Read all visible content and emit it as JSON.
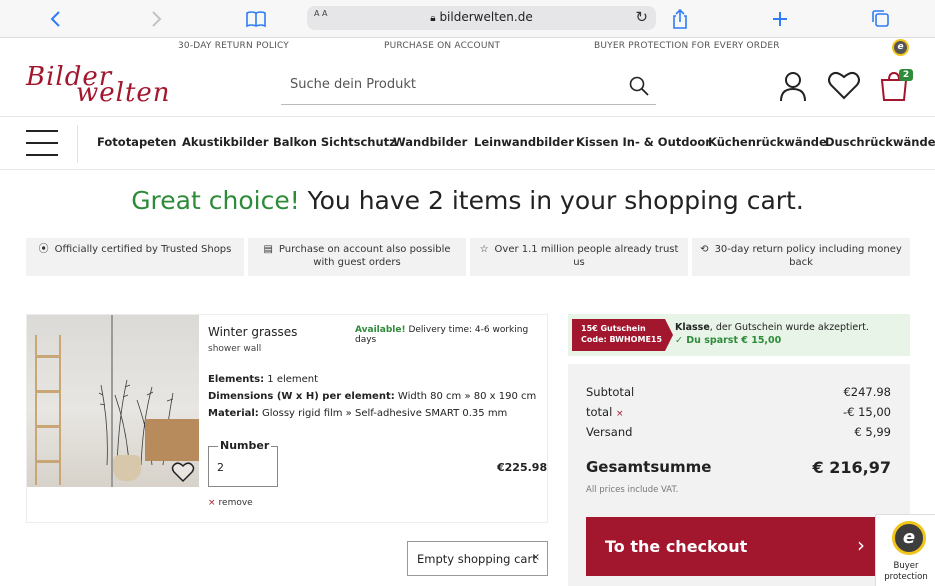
{
  "browser": {
    "url": "bilderwelten.de",
    "reader_label": "A A"
  },
  "usp": [
    "30-DAY RETURN POLICY",
    "PURCHASE ON ACCOUNT",
    "BUYER PROTECTION FOR EVERY ORDER"
  ],
  "header": {
    "logo_line1": "Bilder",
    "logo_line2": "welten",
    "search_placeholder": "Suche dein Produkt",
    "cart_count": "2"
  },
  "nav": {
    "items": [
      "Fototapeten",
      "Akustikbilder",
      "Balkon Sichtschutz",
      "Wandbilder",
      "Leinwandbilder",
      "Kissen In- & Outdoor",
      "Küchenrückwände",
      "Duschrückwände"
    ]
  },
  "headline": {
    "accent": "Great choice!",
    "rest": " You have 2 items in your shopping cart."
  },
  "trust": [
    "Officially certified by Trusted Shops",
    "Purchase on account also possible with guest orders",
    "Over 1.1 million people already trust us",
    "30-day return policy including money back"
  ],
  "product": {
    "title": "Winter grasses",
    "subtitle": "shower wall",
    "availability_label": "Available!",
    "delivery": "Delivery time: 4-6 working days",
    "elements_label": "Elements:",
    "elements_value": "1 element",
    "dimensions_label": "Dimensions (W x H) per element:",
    "dimensions_value": "Width 80 cm » 80 x 190 cm",
    "material_label": "Material:",
    "material_value": "Glossy rigid film » Self-adhesive SMART 0.35 mm",
    "quantity_label": "Number",
    "quantity_value": "2",
    "price": "€225.98",
    "remove_label": "remove"
  },
  "empty_cart_label": "Empty shopping cart",
  "voucher": {
    "tag_line1": "15€ Gutschein",
    "tag_line2": "Code: BWHOME15",
    "msg_bold": "Klasse",
    "msg_rest": ", der Gutschein wurde akzeptiert.",
    "saving": "Du sparst € 15,00"
  },
  "summary": {
    "subtotal_label": "Subtotal",
    "subtotal_value": "€247.98",
    "discount_label": "total",
    "discount_value": "-€ 15,00",
    "shipping_label": "Versand",
    "shipping_value": "€ 5,99",
    "total_label": "Gesamtsumme",
    "total_value": "€ 216,97",
    "vat_note": "All prices include VAT.",
    "checkout_label": "To the checkout"
  },
  "trusted_badge": {
    "line1": "Buyer",
    "line2": "protection"
  },
  "colors": {
    "brand": "#a3172e",
    "accent_green": "#2e8b3a",
    "safari_blue": "#2f7cf6"
  }
}
